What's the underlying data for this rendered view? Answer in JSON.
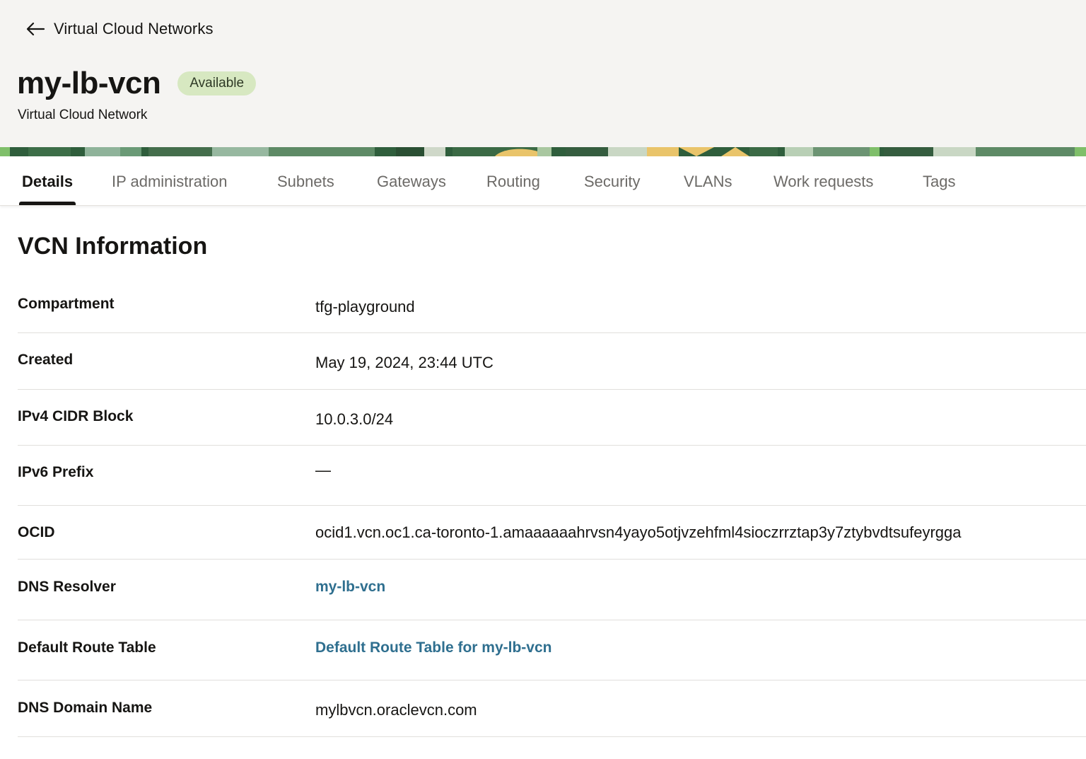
{
  "header": {
    "back_label": "Virtual Cloud Networks",
    "title": "my-lb-vcn",
    "status": "Available",
    "subtitle": "Virtual Cloud Network"
  },
  "tabs": [
    {
      "label": "Details",
      "active": true
    },
    {
      "label": "IP administration",
      "active": false
    },
    {
      "label": "Subnets",
      "active": false
    },
    {
      "label": "Gateways",
      "active": false
    },
    {
      "label": "Routing",
      "active": false
    },
    {
      "label": "Security",
      "active": false
    },
    {
      "label": "VLANs",
      "active": false
    },
    {
      "label": "Work requests",
      "active": false
    },
    {
      "label": "Tags",
      "active": false
    }
  ],
  "section": {
    "title": "VCN Information",
    "rows": [
      {
        "label": "Compartment",
        "value": "tfg-playground"
      },
      {
        "label": "Created",
        "value": "May 19, 2024, 23:44 UTC"
      },
      {
        "label": "IPv4 CIDR Block",
        "value": "10.0.3.0/24"
      },
      {
        "label": "IPv6 Prefix",
        "value": "—"
      },
      {
        "label": "OCID",
        "value": "ocid1.vcn.oc1.ca-toronto-1.amaaaaaahrvsn4yayo5otjvzehfml4sioczrrztap3y7ztybvdtsufeyrgga"
      },
      {
        "label": "DNS Resolver",
        "value": "my-lb-vcn"
      },
      {
        "label": "Default Route Table",
        "value": "Default Route Table for my-lb-vcn"
      },
      {
        "label": "DNS Domain Name",
        "value": "mylbvcn.oraclevcn.com"
      }
    ]
  },
  "colors": {
    "header_background": "#f5f4f2",
    "status_badge": "#d7e8c1",
    "link": "#2f6f8f",
    "active_tab_underline": "#161513"
  },
  "icons": {
    "back": "arrow-left-icon"
  }
}
